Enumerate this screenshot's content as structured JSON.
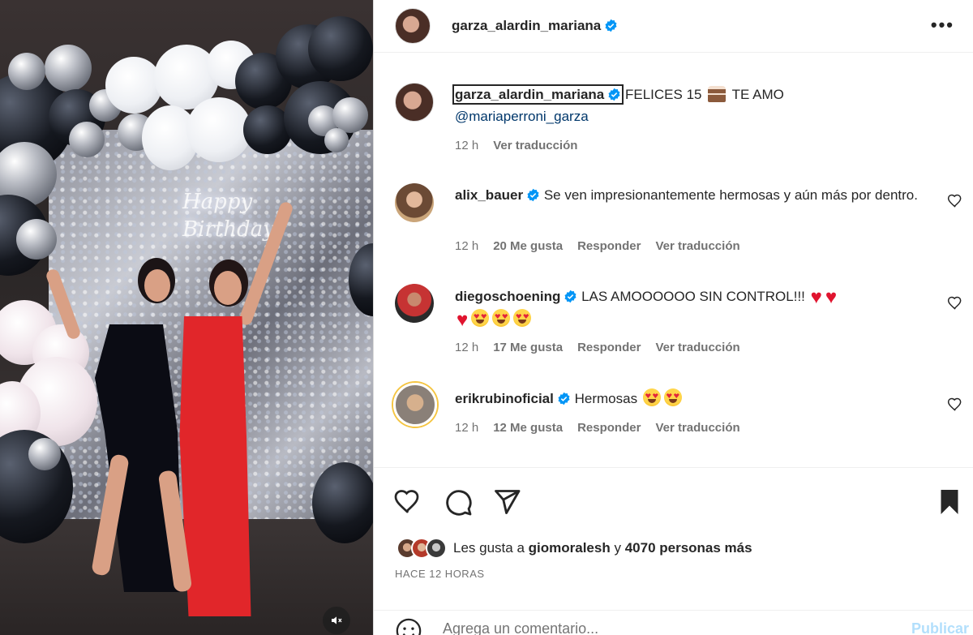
{
  "media": {
    "neon_line1": "Happy",
    "neon_line2": "Birthday",
    "mute_icon": "speaker-muted-icon"
  },
  "header": {
    "username": "garza_alardin_mariana",
    "more_icon": "more-options-icon"
  },
  "caption": {
    "username": "garza_alardin_mariana",
    "text_before": "FELICES 15",
    "text_after": "TE AMO",
    "mention": "@mariaperroni_garza",
    "time": "12 h",
    "translate": "Ver traducción"
  },
  "comments": [
    {
      "username": "alix_bauer",
      "text": "Se ven impresionantemente hermosas y aún más por dentro.",
      "time": "12 h",
      "likes": "20 Me gusta",
      "reply": "Responder",
      "translate": "Ver traducción"
    },
    {
      "username": "diegoschoening",
      "text": "LAS AMOOOOOO SIN CONTROL!!!",
      "time": "12 h",
      "likes": "17 Me gusta",
      "reply": "Responder",
      "translate": "Ver traducción"
    },
    {
      "username": "erikrubinoficial",
      "text": "Hermosas",
      "time": "12 h",
      "likes": "12 Me gusta",
      "reply": "Responder",
      "translate": "Ver traducción"
    }
  ],
  "actions": {
    "like_icon": "heart-icon",
    "comment_icon": "comment-icon",
    "share_icon": "send-icon",
    "save_icon": "bookmark-icon"
  },
  "likes": {
    "prefix": "Les gusta a",
    "first_user": "giomoralesh",
    "connector": "y",
    "others": "4070 personas más"
  },
  "time_ago": "HACE 12 HORAS",
  "add_comment": {
    "placeholder": "Agrega un comentario...",
    "publish": "Publicar"
  },
  "colors": {
    "verified": "#0095f6",
    "link": "#00376b",
    "muted": "#737373",
    "publish_disabled": "#b2dffc"
  }
}
